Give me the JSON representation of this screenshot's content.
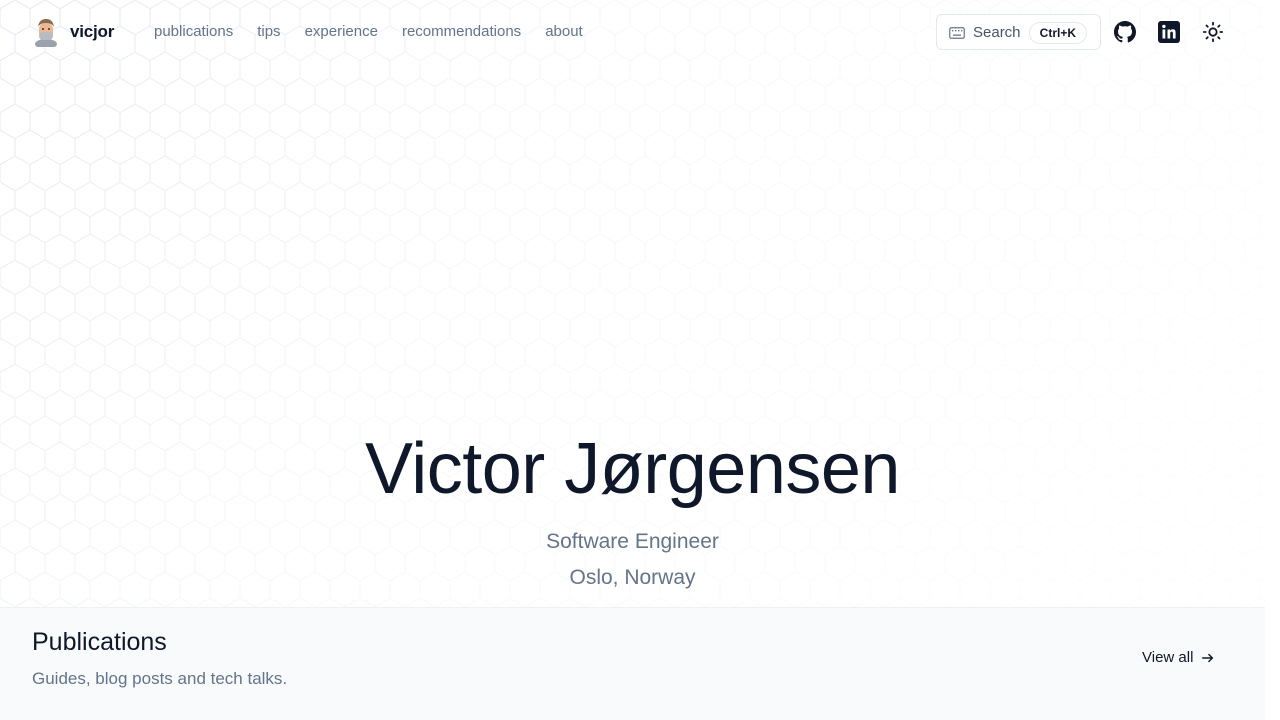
{
  "header": {
    "brand_name": "vicjor",
    "nav": [
      "publications",
      "tips",
      "experience",
      "recommendations",
      "about"
    ],
    "search_label": "Search",
    "search_shortcut": "Ctrl+K"
  },
  "icons": {
    "github": "github-icon",
    "linkedin": "linkedin-icon",
    "theme": "sun-icon",
    "search": "keyboard-icon",
    "arrow": "arrow-right-icon"
  },
  "hero": {
    "name": "Victor Jørgensen",
    "role": "Software Engineer",
    "location": "Oslo, Norway"
  },
  "publications": {
    "title": "Publications",
    "subtitle": "Guides, blog posts and tech talks.",
    "view_all": "View all"
  },
  "colors": {
    "text": "#0f172a",
    "muted": "#64748b",
    "section_bg": "#f8fafc",
    "border": "#e2e8f0"
  }
}
